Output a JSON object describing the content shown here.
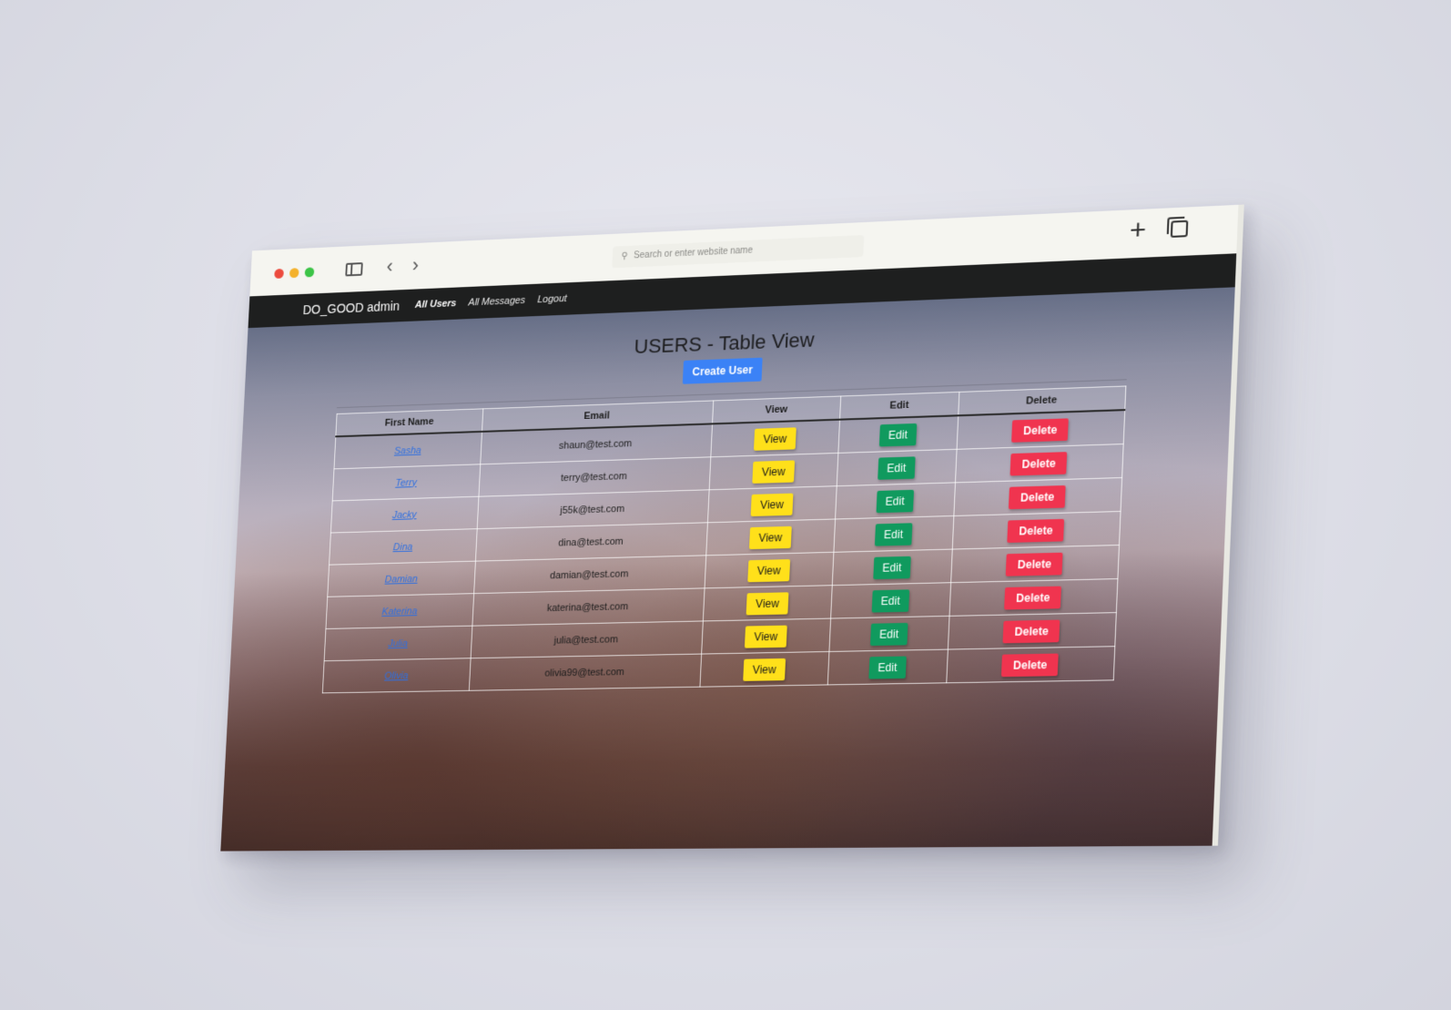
{
  "browser": {
    "address_placeholder": "Search or enter website name"
  },
  "nav": {
    "brand": "DO_GOOD admin",
    "links": [
      "All Users",
      "All Messages",
      "Logout"
    ]
  },
  "page": {
    "title": "USERS - Table View",
    "create_label": "Create User"
  },
  "table": {
    "columns": [
      "First Name",
      "Email",
      "View",
      "Edit",
      "Delete"
    ],
    "rows": [
      {
        "name": "Sasha",
        "email": "shaun@test.com"
      },
      {
        "name": "Terry",
        "email": "terry@test.com"
      },
      {
        "name": "Jacky",
        "email": "j55k@test.com"
      },
      {
        "name": "Dina",
        "email": "dina@test.com"
      },
      {
        "name": "Damian",
        "email": "damian@test.com"
      },
      {
        "name": "Katerina",
        "email": "katerina@test.com"
      },
      {
        "name": "Julia",
        "email": "julia@test.com"
      },
      {
        "name": "Olivia",
        "email": "olivia99@test.com"
      }
    ],
    "view_label": "View",
    "edit_label": "Edit",
    "delete_label": "Delete"
  },
  "colors": {
    "view": "#ffe01a",
    "edit": "#109a5e",
    "delete": "#f0344f",
    "primary": "#3b82f6",
    "navbar": "#1e1f1f"
  },
  "icons": [
    "sidebar-icon",
    "chevron-left-icon",
    "chevron-right-icon",
    "search-icon",
    "plus-icon",
    "tabs-icon"
  ]
}
